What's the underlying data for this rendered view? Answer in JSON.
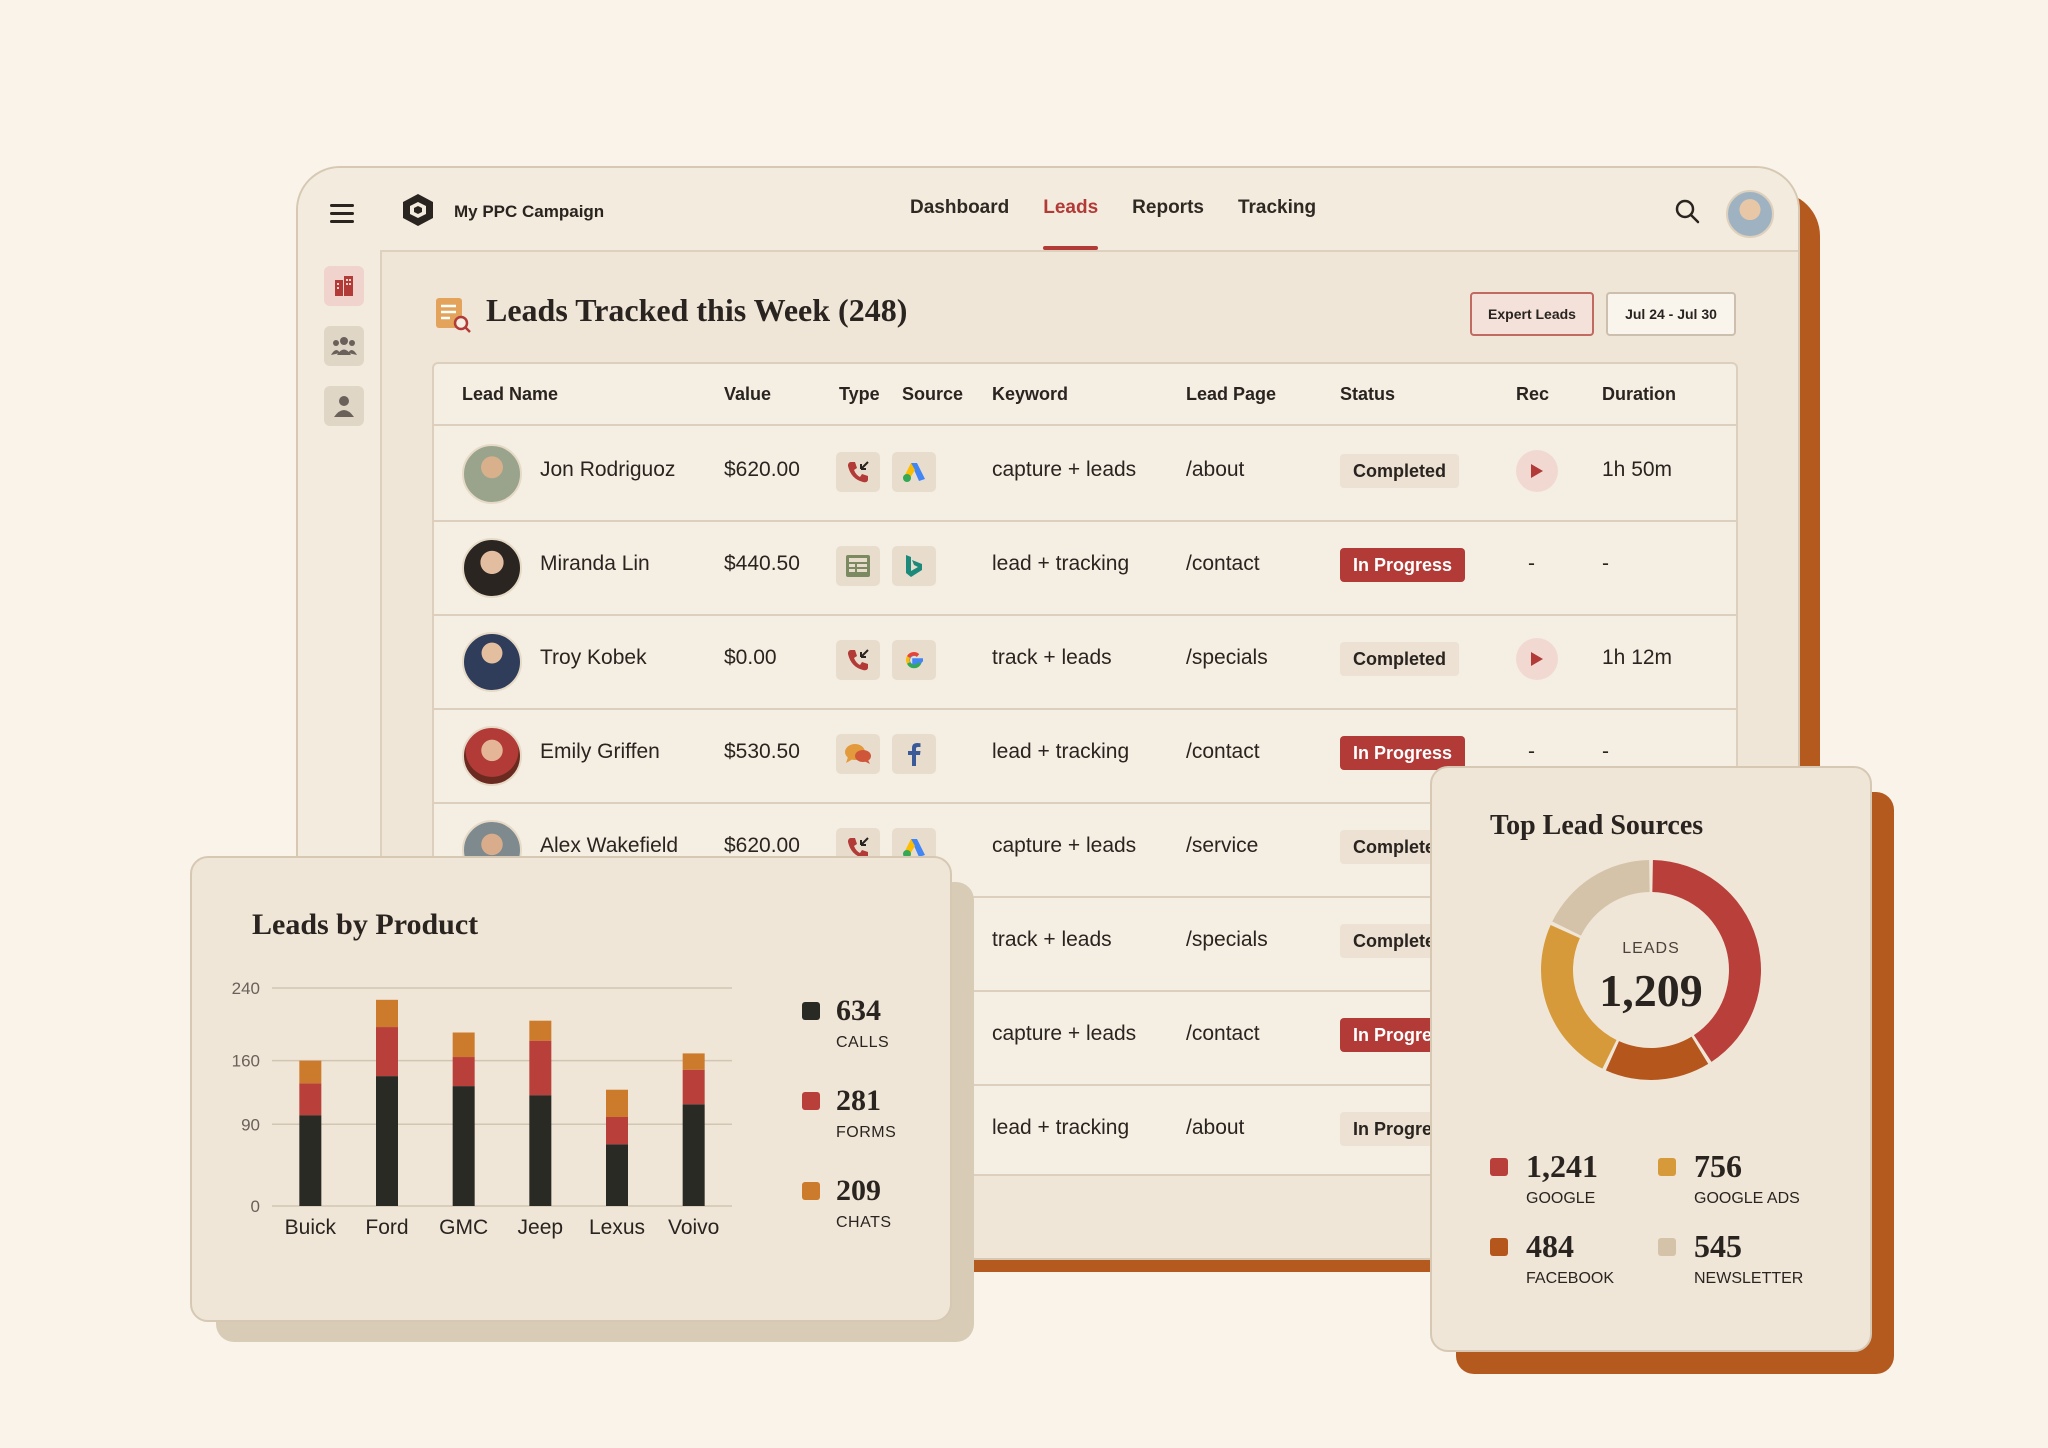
{
  "app": {
    "name": "My PPC Campaign"
  },
  "nav": {
    "items": [
      "Dashboard",
      "Leads",
      "Reports",
      "Tracking"
    ],
    "active": "Leads"
  },
  "page": {
    "title": "Leads Tracked this Week (248)",
    "export_label": "Expert Leads",
    "date_range": "Jul 24 - Jul 30"
  },
  "table": {
    "columns": [
      "Lead Name",
      "Value",
      "Type",
      "Source",
      "Keyword",
      "Lead Page",
      "Status",
      "Rec",
      "Duration"
    ],
    "rows": [
      {
        "name": "Jon Rodriguoz",
        "value": "$620.00",
        "type": "call-icon",
        "source": "google-ads-icon",
        "keyword": "capture + leads",
        "page": "/about",
        "status": "Completed",
        "rec": true,
        "duration": "1h 50m"
      },
      {
        "name": "Miranda Lin",
        "value": "$440.50",
        "type": "form-icon",
        "source": "bing-icon",
        "keyword": "lead + tracking",
        "page": "/contact",
        "status": "In Progress",
        "rec": false,
        "duration": "-"
      },
      {
        "name": "Troy Kobek",
        "value": "$0.00",
        "type": "call-icon",
        "source": "google-icon",
        "keyword": "track + leads",
        "page": "/specials",
        "status": "Completed",
        "rec": true,
        "duration": "1h 12m"
      },
      {
        "name": "Emily Griffen",
        "value": "$530.50",
        "type": "chat-icon",
        "source": "facebook-icon",
        "keyword": "lead + tracking",
        "page": "/contact",
        "status": "In Progress",
        "rec": false,
        "duration": "-"
      },
      {
        "name": "Alex Wakefield",
        "value": "$620.00",
        "type": "call-icon",
        "source": "google-ads-icon",
        "keyword": "capture + leads",
        "page": "/service",
        "status": "Complete",
        "rec": null,
        "duration": ""
      },
      {
        "name": "",
        "value": "",
        "type": "",
        "source": "",
        "keyword": "track + leads",
        "page": "/specials",
        "status": "Complete",
        "rec": null,
        "duration": ""
      },
      {
        "name": "",
        "value": "",
        "type": "",
        "source": "",
        "keyword": "capture + leads",
        "page": "/contact",
        "status": "In Progre",
        "rec": null,
        "duration": ""
      },
      {
        "name": "",
        "value": "",
        "type": "",
        "source": "",
        "keyword": "lead + tracking",
        "page": "/about",
        "status": "In Progre",
        "rec": null,
        "duration": ""
      }
    ],
    "no_rec": "-"
  },
  "chart_data": [
    {
      "type": "bar",
      "stacked": true,
      "title": "Leads by Product",
      "categories": [
        "Buick",
        "Ford",
        "GMC",
        "Jeep",
        "Lexus",
        "Voivo"
      ],
      "y_ticks": [
        0,
        90,
        160,
        240
      ],
      "ylim": [
        0,
        240
      ],
      "grid": true,
      "series": [
        {
          "name": "CALLS",
          "color": "#2a2a24",
          "values": [
            100,
            143,
            132,
            122,
            68,
            112
          ]
        },
        {
          "name": "FORMS",
          "color": "#b93f3b",
          "values": [
            35,
            54,
            32,
            60,
            30,
            38
          ]
        },
        {
          "name": "CHATS",
          "color": "#cc7a2c",
          "values": [
            25,
            30,
            27,
            22,
            30,
            18
          ]
        }
      ],
      "totals": [
        {
          "value": "634",
          "label": "CALLS",
          "color": "#2a2a24"
        },
        {
          "value": "281",
          "label": "FORMS",
          "color": "#b93f3b"
        },
        {
          "value": "209",
          "label": "CHATS",
          "color": "#cc7a2c"
        }
      ],
      "legend_position": "right"
    },
    {
      "type": "pie",
      "donut": true,
      "title": "Top Lead Sources",
      "center_label": "LEADS",
      "center_value": "1,209",
      "slices": [
        {
          "label": "GOOGLE",
          "display": "1,241",
          "value": 1241,
          "color": "#b93f3b"
        },
        {
          "label": "FACEBOOK",
          "display": "484",
          "value": 484,
          "color": "#b5561c"
        },
        {
          "label": "GOOGLE ADS",
          "display": "756",
          "value": 756,
          "color": "#d79a3a"
        },
        {
          "label": "NEWSLETTER",
          "display": "545",
          "value": 545,
          "color": "#d4c3a9"
        }
      ],
      "legend_position": "bottom"
    }
  ]
}
